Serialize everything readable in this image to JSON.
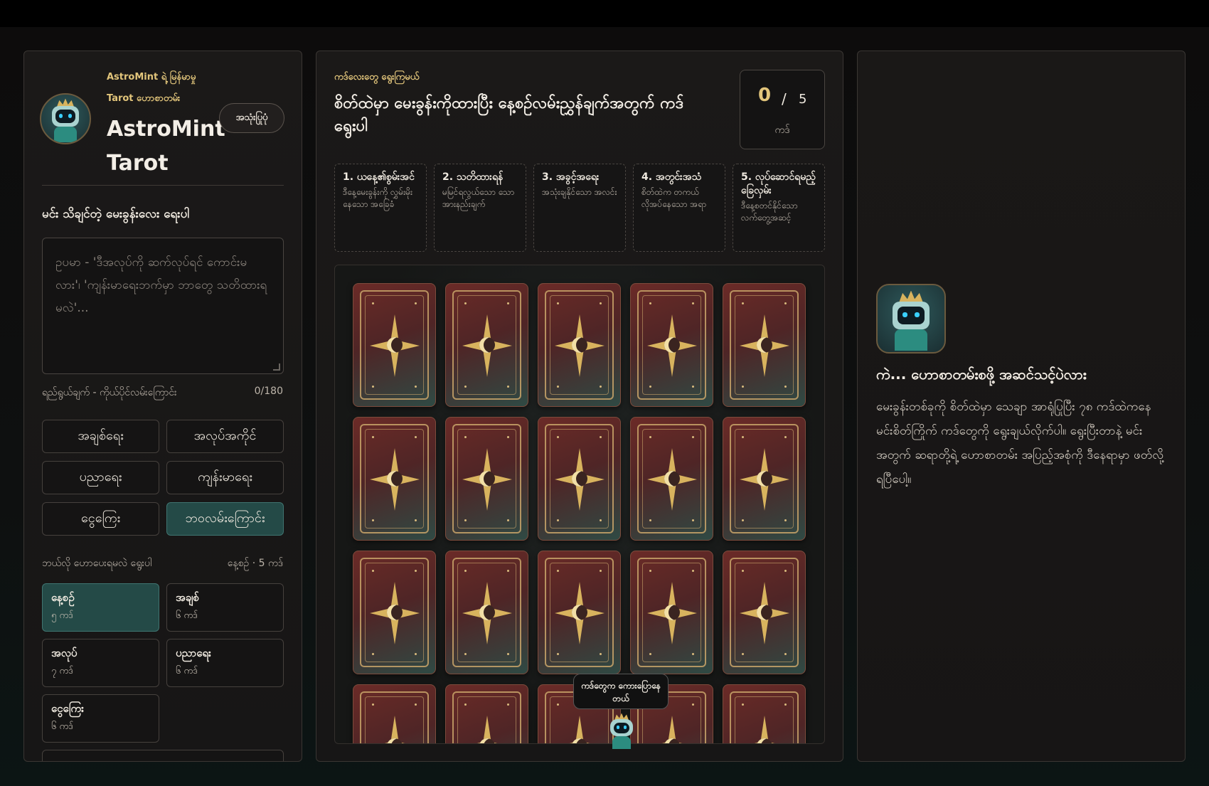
{
  "brand": {
    "subtitle_line1": "AstroMint ရဲ့ မြန်မာမှု",
    "subtitle_line2": "Tarot ဟောစာတမ်း",
    "title": "AstroMint Tarot",
    "guide_button": "အသုံးပြုပုံ"
  },
  "question": {
    "label": "မင်း သိချင်တဲ့ မေးခွန်းလေး ရေးပါ",
    "placeholder": "ဥပမာ - 'ဒီအလုပ်ကို ဆက်လုပ်ရင် ကောင်းမလား'၊ 'ကျန်းမာရေးဘက်မှာ ဘာတွေ သတိထားရမလဲ'...",
    "hint": "ရည်ရွယ်ချက် - ကိုယ်ပိုင်လမ်းကြောင်း",
    "char_count": "0/180"
  },
  "topics": [
    {
      "label": "အချစ်ရေး",
      "active": false
    },
    {
      "label": "အလုပ်အကိုင်",
      "active": false
    },
    {
      "label": "ပညာရေး",
      "active": false
    },
    {
      "label": "ကျန်းမာရေး",
      "active": false
    },
    {
      "label": "ငွေကြေး",
      "active": false
    },
    {
      "label": "ဘဝလမ်းကြောင်း",
      "active": true
    }
  ],
  "spread_section": {
    "label": "ဘယ်လို ဟောပေးရမလဲ ရွေးပါ",
    "selected_summary": "နေ့စဉ် · 5 ကဒ်"
  },
  "spreads": [
    {
      "name": "နေ့စဉ်",
      "count": "၅ ကဒ်",
      "active": true
    },
    {
      "name": "အချစ်",
      "count": "၆ ကဒ်",
      "active": false
    },
    {
      "name": "အလုပ်",
      "count": "၇ ကဒ်",
      "active": false
    },
    {
      "name": "ပညာရေး",
      "count": "၆ ကဒ်",
      "active": false
    },
    {
      "name": "ငွေကြေး",
      "count": "၆ ကဒ်",
      "active": false
    }
  ],
  "deck": {
    "kicker": "ကဒ်လေးတွေ ရွေးကြမယ်",
    "title": "စိတ်ထဲမှာ မေးခွန်းကိုထားပြီး နေ့စဉ်လမ်းညွှန်ချက်အတွက် ကဒ်ရွေးပါ",
    "selected": "0",
    "separator": "/",
    "total": "5",
    "unit": "ကဒ်",
    "shuffle_tooltip": "ကဒ်တွေက ကေားပြောနေတယ်"
  },
  "positions": [
    {
      "title": "1. ယနေ့၏စွမ်းအင်",
      "desc": "ဒီနေ့မေးခွန်းကို လွှမ်းမိုးနေသော အခြေခံ"
    },
    {
      "title": "2. သတိထားရန်",
      "desc": "မမြင်ရလွယ်သော သော အားနည်းချက်"
    },
    {
      "title": "3. အခွင့်အရေး",
      "desc": "အသုံးချနိုင်သော အလင်း"
    },
    {
      "title": "4. အတွင်းအသံ",
      "desc": "စိတ်ထဲက တကယ် လိုအပ်နေသော အရာ"
    },
    {
      "title": "5. လုပ်ဆောင်ရမည့်ခြေလှမ်း",
      "desc": "ဒီနေ့စတင်နိုင်သော လက်တွေ့အဆင့်"
    }
  ],
  "reading": {
    "title": "ကဲ... ဟောစာတမ်းစဖို့ အဆင်သင့်ပဲလား",
    "body": "မေးခွန်းတစ်ခုကို စိတ်ထဲမှာ သေချာ အာရုံပြုပြီး ၇၈ ကဒ်ထဲကနေ မင်းစိတ်ကြိုက် ကဒ်တွေကို ရွေးချယ်လိုက်ပါ။ ရွေးပြီးတာနဲ့ မင်းအတွက် ဆရာတို့ရဲ့ ဟောစာတမ်း အပြည့်အစုံကို ဒီနေရာမှာ ဖတ်လို့ ရပြီပေါ့။"
  },
  "colors": {
    "accent_gold": "#e2c57b",
    "active_teal": "#244a47",
    "card_red": "#6b2b27"
  }
}
